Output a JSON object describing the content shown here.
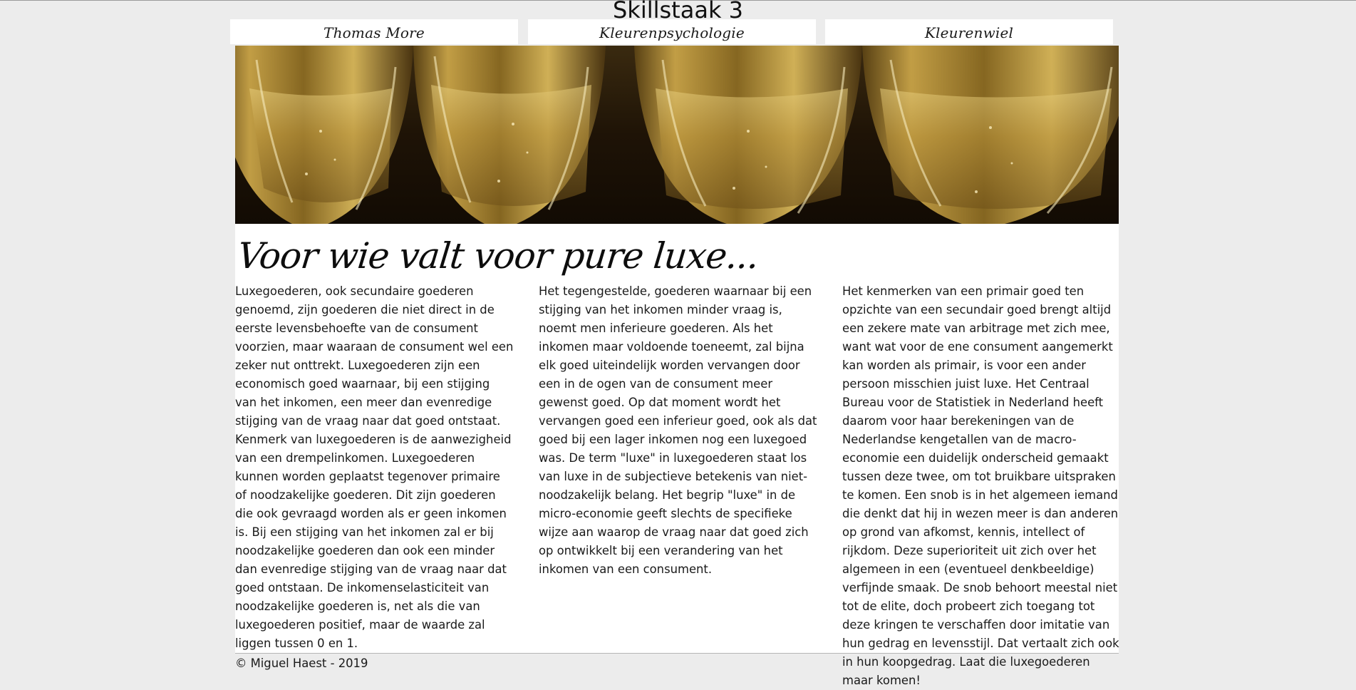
{
  "page": {
    "title": "Skillstaak 3"
  },
  "nav": {
    "items": [
      {
        "label": "Thomas More"
      },
      {
        "label": "Kleurenpsychologie"
      },
      {
        "label": "Kleurenwiel"
      }
    ]
  },
  "hero": {
    "subject": "champagne-glasses-photo",
    "colors": {
      "dark": "#2a1a08",
      "gold": "#c9a448",
      "highlight": "#f2e2a4"
    }
  },
  "article": {
    "heading": "Voor wie valt voor pure luxe...",
    "columns": [
      {
        "text": "Luxegoederen, ook secundaire goederen genoemd, zijn goederen die niet direct in de eerste levensbehoefte van de consument voorzien, maar waaraan de consument wel een zeker nut onttrekt. Luxegoederen zijn een economisch goed waarnaar, bij een stijging van het inkomen, een meer dan evenredige stijging van de vraag naar dat goed ontstaat. Kenmerk van luxegoederen is de aanwezigheid van een drempelinkomen. Luxegoederen kunnen worden geplaatst tegenover primaire of noodzakelijke goederen. Dit zijn goederen die ook gevraagd worden als er geen inkomen is. Bij een stijging van het inkomen zal er bij noodzakelijke goederen dan ook een minder dan evenredige stijging van de vraag naar dat goed ontstaan. De inkomenselasticiteit van noodzakelijke goederen is, net als die van luxegoederen positief, maar de waarde zal liggen tussen 0 en 1."
      },
      {
        "text": "Het tegengestelde, goederen waarnaar bij een stijging van het inkomen minder vraag is, noemt men inferieure goederen. Als het inkomen maar voldoende toeneemt, zal bijna elk goed uiteindelijk worden vervangen door een in de ogen van de consument meer gewenst goed. Op dat moment wordt het vervangen goed een inferieur goed, ook als dat goed bij een lager inkomen nog een luxegoed was. De term \"luxe\" in luxegoederen staat los van luxe in de subjectieve betekenis van niet-noodzakelijk belang. Het begrip \"luxe\" in de micro-economie geeft slechts de specifieke wijze aan waarop de vraag naar dat goed zich op ontwikkelt bij een verandering van het inkomen van een consument."
      },
      {
        "text": "Het kenmerken van een primair goed ten opzichte van een secundair goed brengt altijd een zekere mate van arbitrage met zich mee, want wat voor de ene consument aangemerkt kan worden als primair, is voor een ander persoon misschien juist luxe. Het Centraal Bureau voor de Statistiek in Nederland heeft daarom voor haar berekeningen van de Nederlandse kengetallen van de macro-economie een duidelijk onderscheid gemaakt tussen deze twee, om tot bruikbare uitspraken te komen. Een snob is in het algemeen iemand die denkt dat hij in wezen meer is dan anderen op grond van afkomst, kennis, intellect of rijkdom. Deze superioriteit uit zich over het algemeen in een (eventueel denkbeeldige) verfijnde smaak. De snob behoort meestal niet tot de elite, doch probeert zich toegang tot deze kringen te verschaffen door imitatie van hun gedrag en levensstijl. Dat vertaalt zich ook in hun koopgedrag. Laat die luxegoederen maar komen!"
      }
    ]
  },
  "footer": {
    "text": "© Miguel Haest - 2019"
  }
}
